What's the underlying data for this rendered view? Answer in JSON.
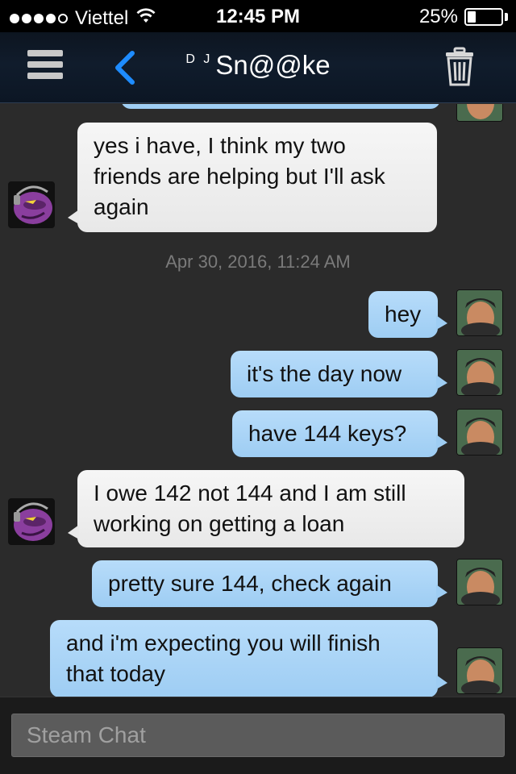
{
  "status_bar": {
    "carrier": "Viettel",
    "time": "12:45 PM",
    "battery_percent": "25%",
    "battery_level": 0.25,
    "signal_bars": 4,
    "signal_max": 5
  },
  "header": {
    "title_prefix": "D J",
    "title": "Sn@@ke",
    "icons": [
      "menu-icon",
      "back-chevron-icon",
      "trash-icon"
    ],
    "accent_color": "#1e8cff"
  },
  "messages": [
    {
      "id": "m0",
      "side": "out",
      "text": ""
    },
    {
      "id": "m1",
      "side": "in",
      "lines": [
        "yes i have, I think my two",
        "friends are helping but I'll ask",
        "again"
      ]
    },
    {
      "id": "ts",
      "type": "timestamp",
      "text": "Apr 30, 2016, 11:24 AM"
    },
    {
      "id": "m2",
      "side": "out",
      "lines": [
        "hey"
      ]
    },
    {
      "id": "m3",
      "side": "out",
      "lines": [
        "it's the day now"
      ]
    },
    {
      "id": "m4",
      "side": "out",
      "lines": [
        "have 144 keys?"
      ]
    },
    {
      "id": "m5",
      "side": "in",
      "lines": [
        "I owe 142 not 144 and I am still",
        "working on getting a loan"
      ]
    },
    {
      "id": "m6",
      "side": "out",
      "lines": [
        "pretty sure 144, check again"
      ]
    },
    {
      "id": "m7",
      "side": "out",
      "lines": [
        "and i'm expecting you will finish",
        "that today"
      ]
    }
  ],
  "input": {
    "placeholder": "Steam Chat",
    "value": ""
  }
}
